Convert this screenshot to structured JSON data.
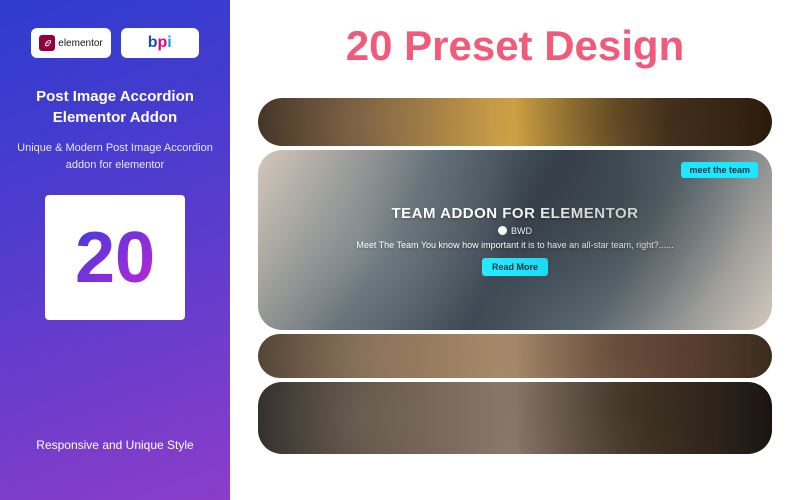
{
  "sidebar": {
    "elementor_label": "elementor",
    "bpi_b": "b",
    "bpi_p": "p",
    "bpi_i": "i",
    "title": "Post Image Accordion Elementor Addon",
    "subtitle": "Unique & Modern Post Image Accordion addon for elementor",
    "count": "20",
    "bottom": "Responsive and Unique Style"
  },
  "main": {
    "headline": "20 Preset Design",
    "tag": "meet the team",
    "slice_title": "TEAM ADDON FOR ELEMENTOR",
    "author": "BWD",
    "desc": "Meet The Team You know how important it is to have an all-star team, right?......",
    "read_more": "Read More"
  }
}
